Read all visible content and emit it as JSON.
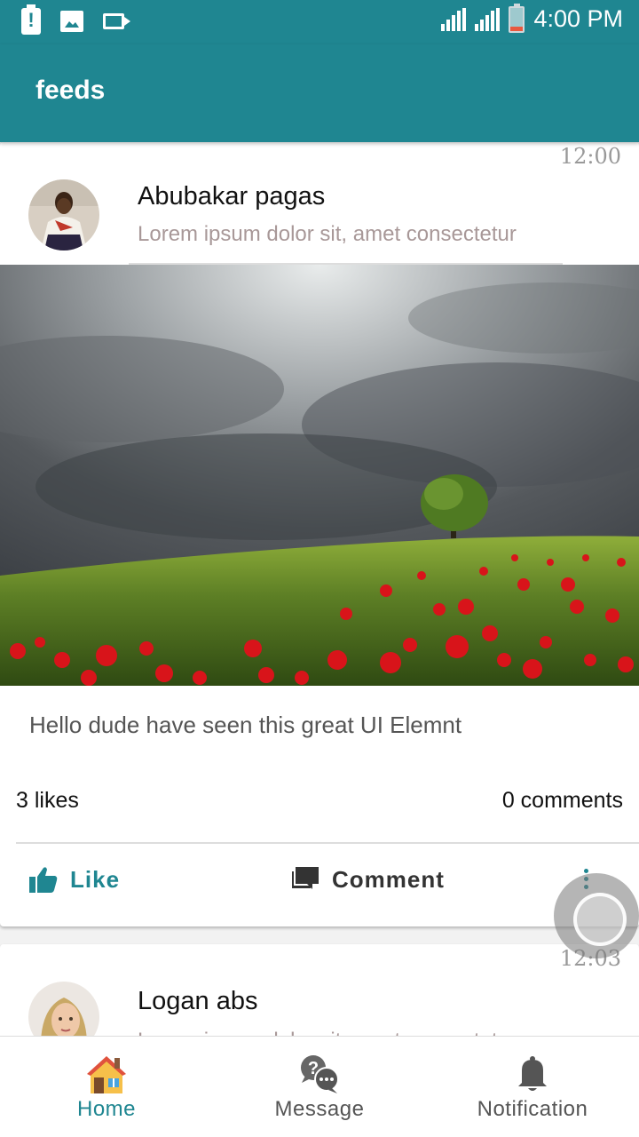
{
  "status_bar": {
    "time": "4:00 PM",
    "icons": [
      "battery-alert-icon",
      "image-icon",
      "video-icon",
      "signal-icon",
      "signal-icon",
      "battery-icon"
    ]
  },
  "app_bar": {
    "title": "feeds"
  },
  "posts": [
    {
      "time": "12:00",
      "author": "Abubakar pagas",
      "preview": "Lorem ipsum dolor sit, amet consectetur",
      "text": "Hello dude have seen this great UI Elemnt",
      "likes": "3 likes",
      "comments": "0 comments",
      "actions": {
        "like": "Like",
        "comment": "Comment"
      }
    },
    {
      "time": "12:03",
      "author": "Logan abs",
      "preview": "Lorem ipsum dolor sit, amet consectetur"
    }
  ],
  "bottom_nav": {
    "items": [
      {
        "label": "Home",
        "icon": "house-icon",
        "active": true
      },
      {
        "label": "Message",
        "icon": "chat-bubble-icon",
        "active": false
      },
      {
        "label": "Notification",
        "icon": "bell-icon",
        "active": false
      }
    ]
  },
  "colors": {
    "primary": "#1f8691",
    "accent": "#1f8691"
  }
}
